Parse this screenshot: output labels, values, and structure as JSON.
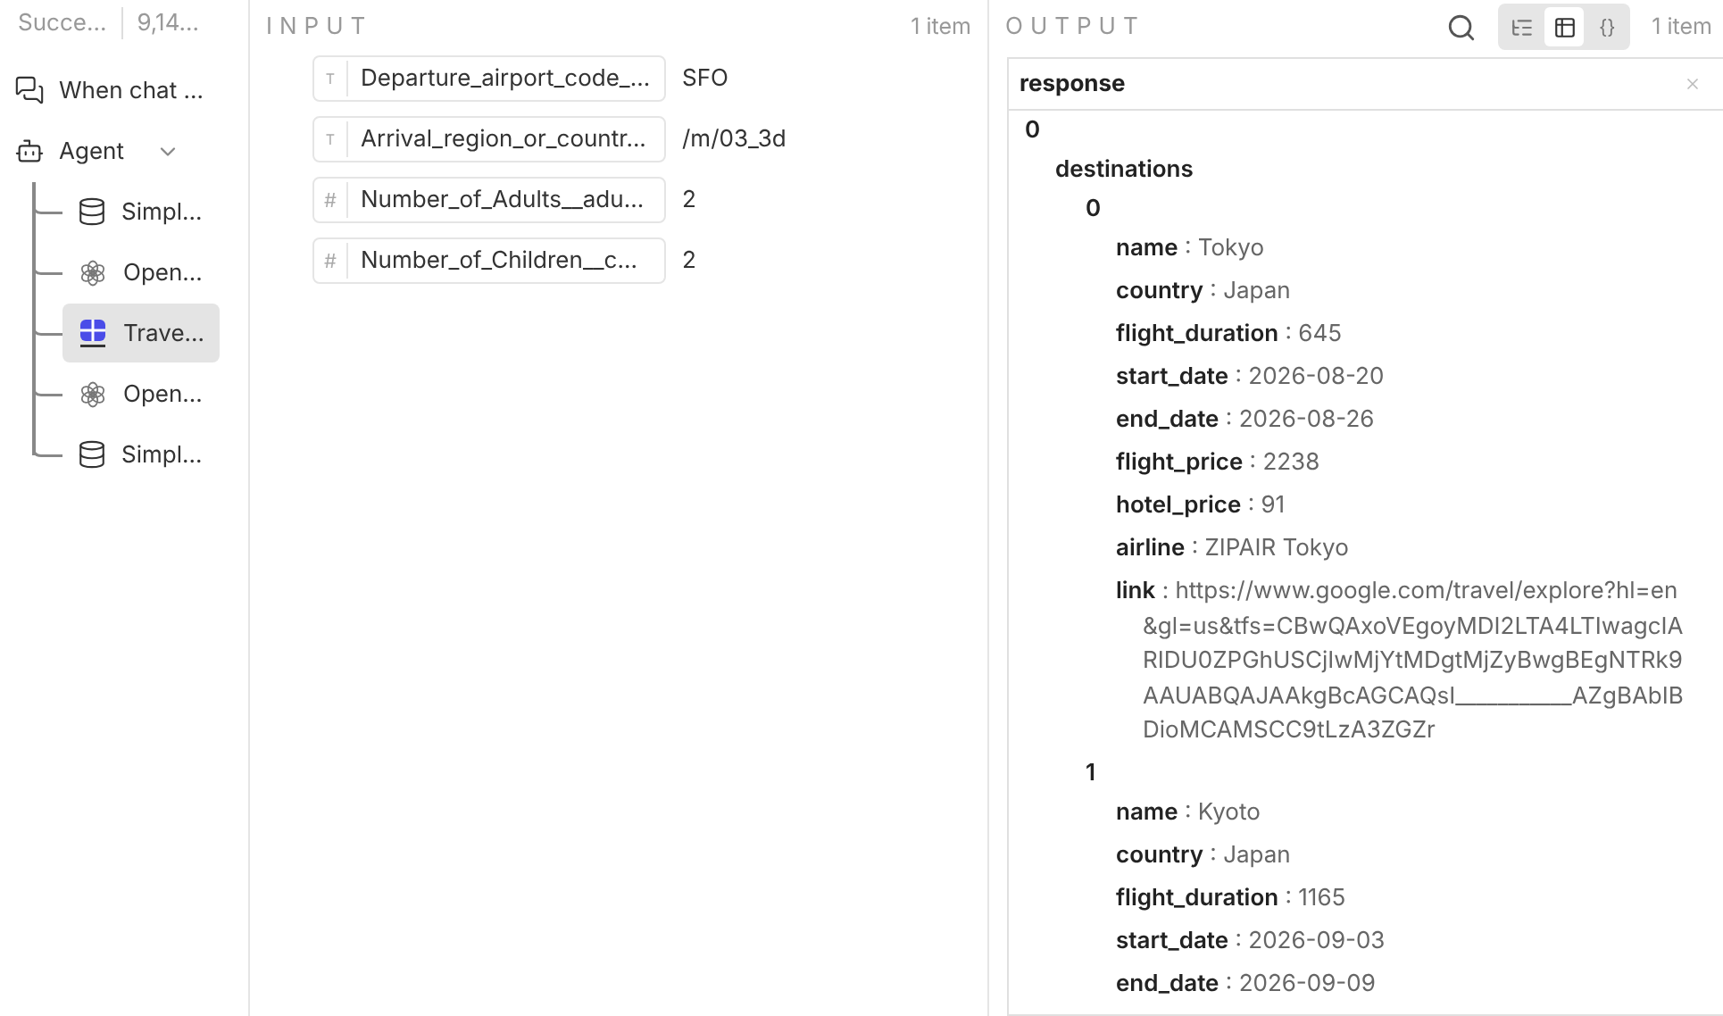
{
  "sidebar": {
    "status": "Succe...",
    "count": "9,14...",
    "items": [
      {
        "kind": "chat",
        "label": "When chat ...",
        "selected": false
      },
      {
        "kind": "agent",
        "label": "Agent",
        "selected": false,
        "expanded": true,
        "children": [
          {
            "kind": "database",
            "label": "Simpl...",
            "selected": false
          },
          {
            "kind": "openai",
            "label": "Open...",
            "selected": false
          },
          {
            "kind": "serpapi",
            "label": "Trave...",
            "selected": true
          },
          {
            "kind": "openai",
            "label": "Open...",
            "selected": false
          },
          {
            "kind": "database",
            "label": "Simpl...",
            "selected": false
          }
        ]
      }
    ]
  },
  "input": {
    "title": "INPUT",
    "count": "1 item",
    "fields": [
      {
        "type_glyph": "T",
        "name": "Departure_airport_code_...",
        "value": "SFO"
      },
      {
        "type_glyph": "T",
        "name": "Arrival_region_or_countr...",
        "value": "/m/03_3d"
      },
      {
        "type_glyph": "#",
        "name": "Number_of_Adults__adu...",
        "value": "2"
      },
      {
        "type_glyph": "#",
        "name": "Number_of_Children__c...",
        "value": "2"
      }
    ]
  },
  "output": {
    "title": "OUTPUT",
    "count": "1 item",
    "view_modes": [
      {
        "kind": "schema",
        "selected": false
      },
      {
        "kind": "table",
        "selected": true
      },
      {
        "kind": "json",
        "label": "{}",
        "selected": false
      }
    ],
    "column": "response",
    "key_separator": ":",
    "tree": [
      {
        "key": "0",
        "children": [
          {
            "key": "destinations",
            "children": [
              {
                "key": "0",
                "children": [
                  {
                    "key": "name",
                    "value": "Tokyo"
                  },
                  {
                    "key": "country",
                    "value": "Japan"
                  },
                  {
                    "key": "flight_duration",
                    "value": "645"
                  },
                  {
                    "key": "start_date",
                    "value": "2026-08-20"
                  },
                  {
                    "key": "end_date",
                    "value": "2026-08-26"
                  },
                  {
                    "key": "flight_price",
                    "value": "2238"
                  },
                  {
                    "key": "hotel_price",
                    "value": "91"
                  },
                  {
                    "key": "airline",
                    "value": "ZIPAIR Tokyo"
                  },
                  {
                    "key": "link",
                    "value": "https://www.google.com/travel/explore?hl=en&gl=us&tfs=CBwQAxoVEgoyMDI2LTA4LTIwagcIARIDU0ZPGhUSCjIwMjYtMDgtMjZyBwgBEgNTRk9AAUABQAJAAkgBcAGCAQsI___________AZgBAbIBDioMCAMSCC9tLzA3ZGZr"
                  }
                ]
              },
              {
                "key": "1",
                "children": [
                  {
                    "key": "name",
                    "value": "Kyoto"
                  },
                  {
                    "key": "country",
                    "value": "Japan"
                  },
                  {
                    "key": "flight_duration",
                    "value": "1165"
                  },
                  {
                    "key": "start_date",
                    "value": "2026-09-03"
                  },
                  {
                    "key": "end_date",
                    "value": "2026-09-09"
                  }
                ]
              }
            ]
          }
        ]
      }
    ]
  }
}
